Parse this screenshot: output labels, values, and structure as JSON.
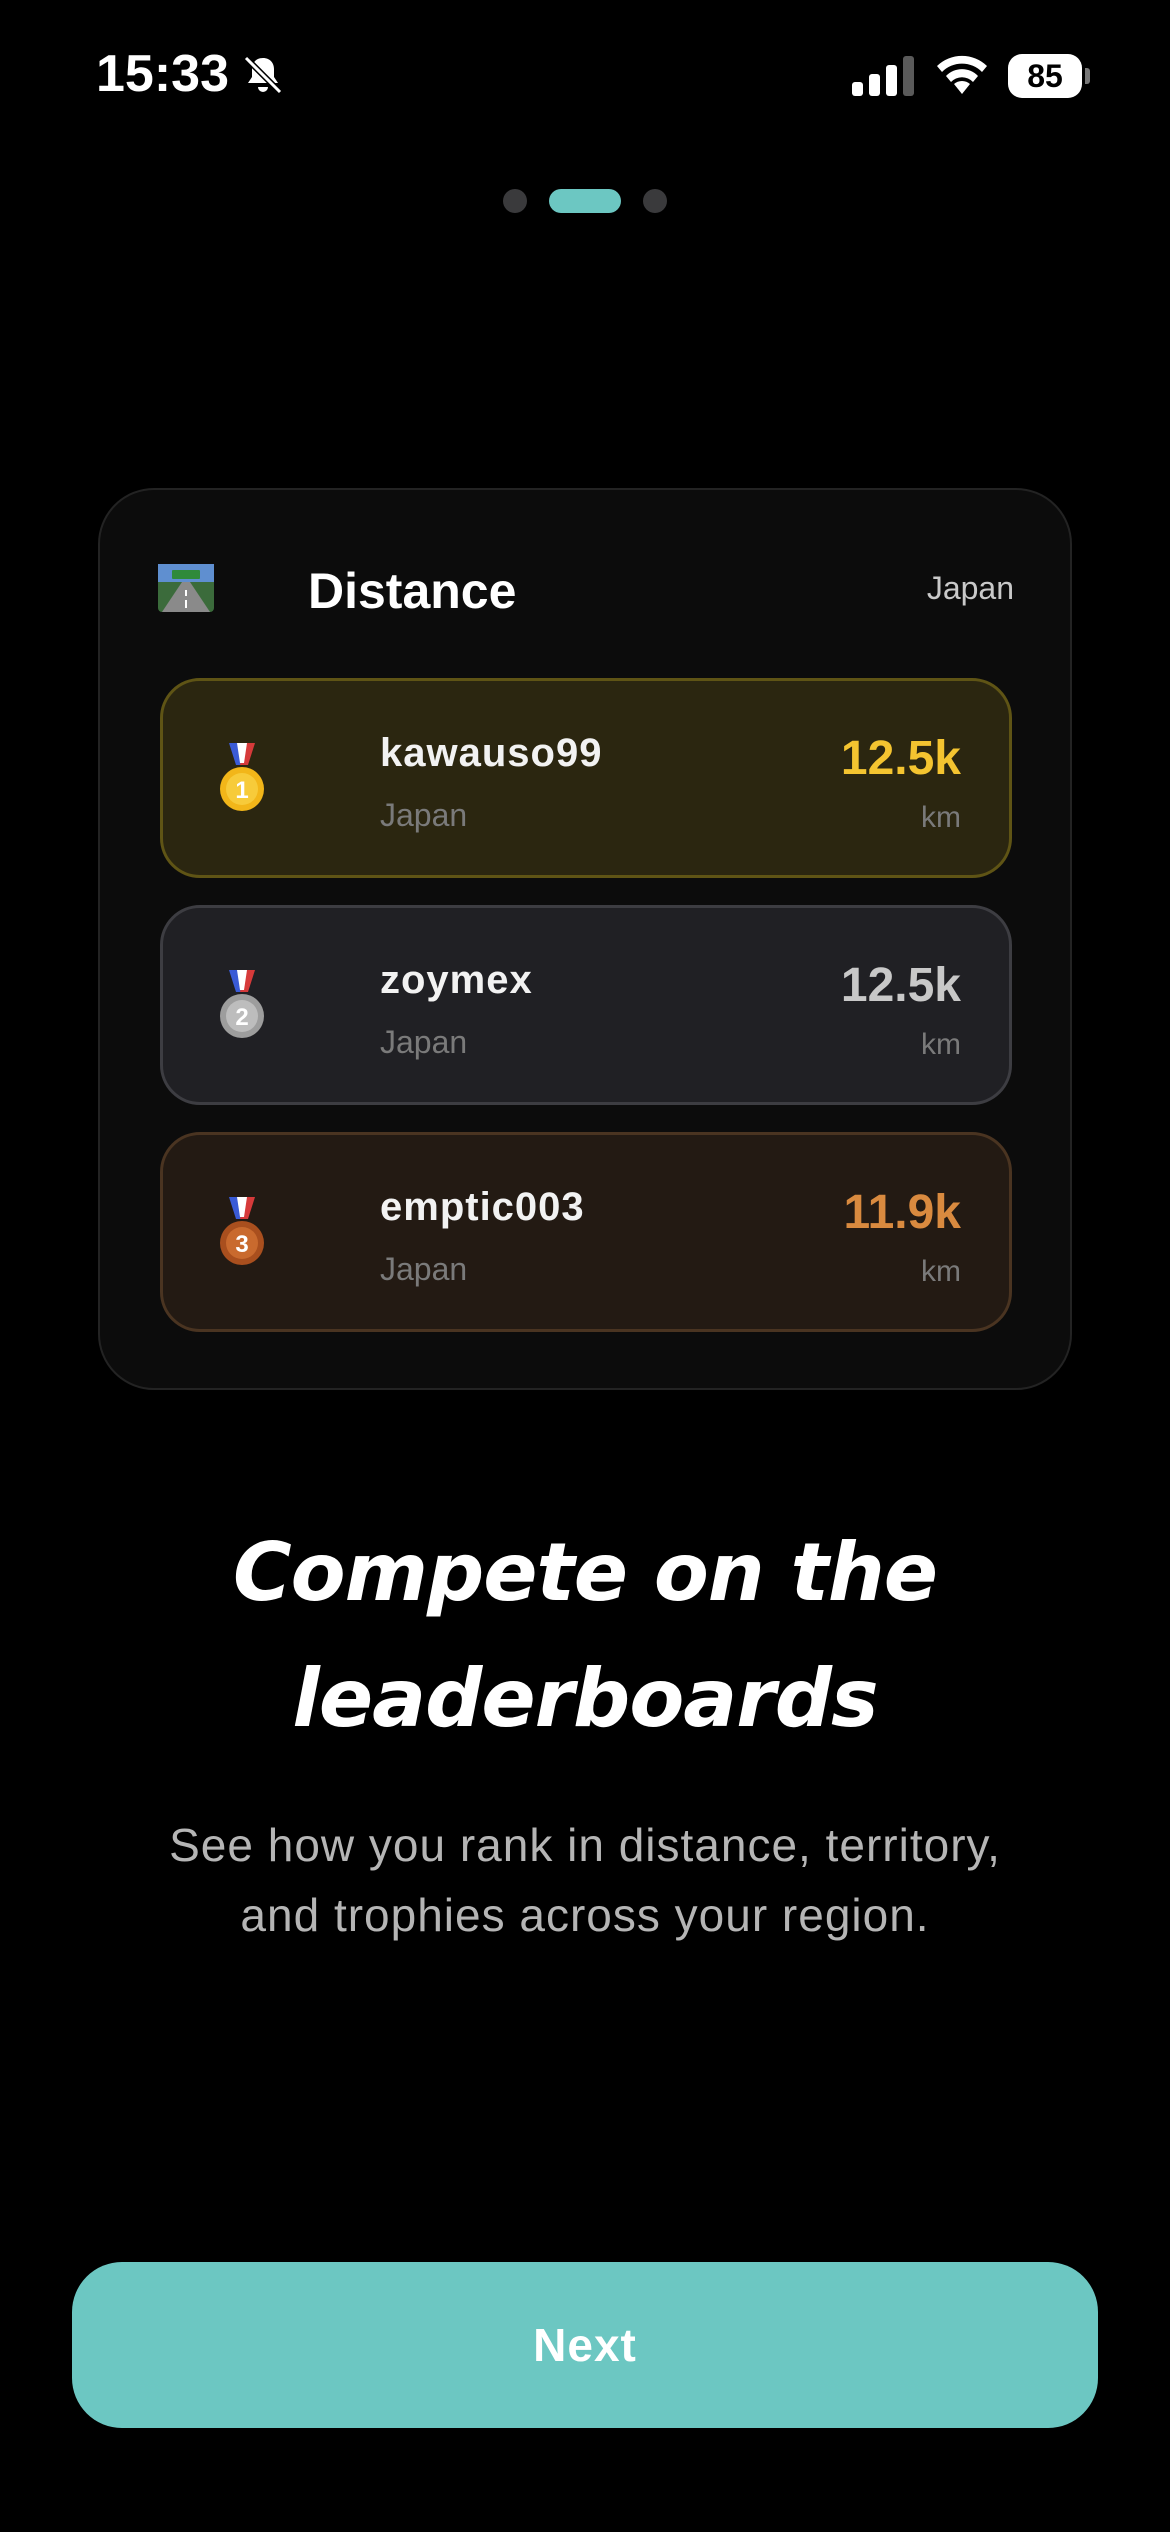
{
  "status_bar": {
    "time": "15:33",
    "battery_percent": "85",
    "silent_mode_icon": "bell-slash-icon",
    "signal_icon": "cellular-signal-icon",
    "wifi_icon": "wifi-icon"
  },
  "pager": {
    "total_pages": 3,
    "active_index": 1,
    "active_color": "#6cc7c2"
  },
  "leaderboard": {
    "icon": "motorway-icon",
    "title": "Distance",
    "region": "Japan",
    "entries": [
      {
        "rank": "1",
        "medal": "gold-medal-icon",
        "name": "kawauso99",
        "region": "Japan",
        "distance": "12.5k",
        "unit": "km",
        "color": "#f4c430"
      },
      {
        "rank": "2",
        "medal": "silver-medal-icon",
        "name": "zoymex",
        "region": "Japan",
        "distance": "12.5k",
        "unit": "km",
        "color": "#c8c8c8"
      },
      {
        "rank": "3",
        "medal": "bronze-medal-icon",
        "name": "emptic003",
        "region": "Japan",
        "distance": "11.9k",
        "unit": "km",
        "color": "#d98a3f"
      }
    ]
  },
  "onboarding": {
    "headline_line1": "Compete on the",
    "headline_line2": "leaderboards",
    "subtitle_line1": "See how you rank in distance, territory,",
    "subtitle_line2": "and trophies across your region."
  },
  "actions": {
    "next_label": "Next",
    "next_color": "#6cc7c2"
  }
}
